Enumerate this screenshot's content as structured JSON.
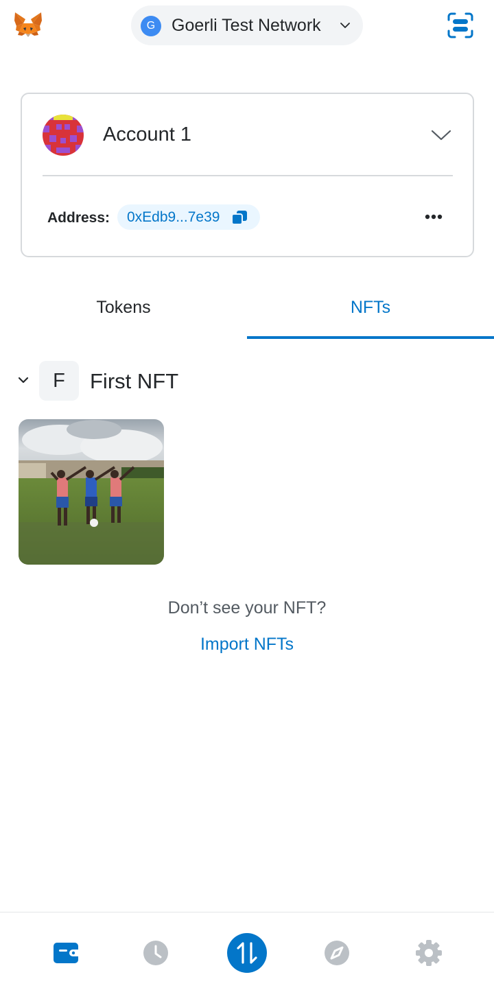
{
  "header": {
    "network_badge_letter": "G",
    "network_name": "Goerli Test Network",
    "logo_icon": "metamask-fox-icon",
    "scan_icon": "qr-scan-icon"
  },
  "account": {
    "name": "Account 1",
    "address_label": "Address:",
    "address_short": "0xEdb9...7e39",
    "copy_icon": "copy-icon",
    "more_icon": "more-options-icon"
  },
  "tabs": [
    {
      "label": "Tokens",
      "active": false
    },
    {
      "label": "NFTs",
      "active": true
    }
  ],
  "collection": {
    "letter": "F",
    "name": "First NFT"
  },
  "empty_prompt": {
    "text": "Don’t see your NFT?",
    "link": "Import NFTs"
  },
  "bottom_nav": [
    {
      "icon": "wallet-icon",
      "active": true
    },
    {
      "icon": "activity-clock-icon",
      "active": false
    },
    {
      "icon": "swap-arrows-icon",
      "active": false
    },
    {
      "icon": "browser-compass-icon",
      "active": false
    },
    {
      "icon": "settings-gear-icon",
      "active": false
    }
  ],
  "colors": {
    "accent": "#0376c9",
    "text": "#24272a",
    "muted": "#535a61",
    "border": "#d6d9dc",
    "pill_bg": "#f2f4f6",
    "address_bg": "#eaf6ff",
    "nav_inactive": "#bbc0c5",
    "network_badge": "#3d8bf2"
  }
}
